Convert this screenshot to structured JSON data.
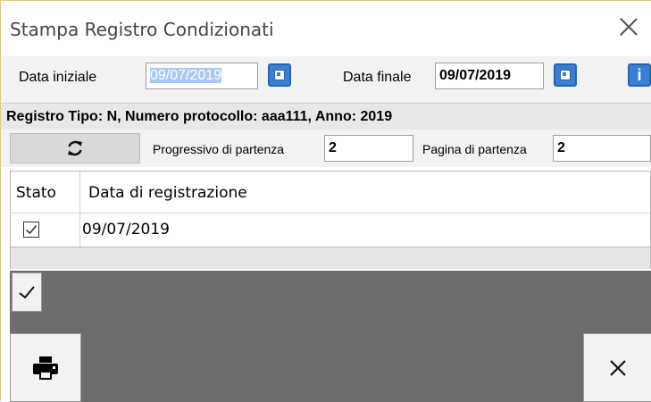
{
  "window": {
    "title": "Stampa Registro Condizionati"
  },
  "dates": {
    "start_label": "Data iniziale",
    "start_value": "09/07/2019",
    "end_label": "Data finale",
    "end_value": "09/07/2019"
  },
  "registro": {
    "info": "Registro Tipo: N, Numero protocollo: aaa111, Anno: 2019"
  },
  "progressivo": {
    "label": "Progressivo di partenza",
    "value": "2",
    "pagina_label": "Pagina di partenza",
    "pagina_value": "2"
  },
  "table": {
    "columns": [
      "Stato",
      "Data di registrazione"
    ],
    "rows": [
      {
        "checked": true,
        "date": "09/07/2019"
      }
    ]
  },
  "icons": {
    "close": "close-icon",
    "calendar": "calendar-icon",
    "info": "info-icon",
    "refresh": "refresh-icon",
    "check": "check-icon",
    "print": "printer-icon",
    "cancel": "x-icon"
  },
  "colors": {
    "accent": "#3a7fd6",
    "selection": "#a9c9f5",
    "panel": "#6d6d6d",
    "border": "#e3c887"
  }
}
